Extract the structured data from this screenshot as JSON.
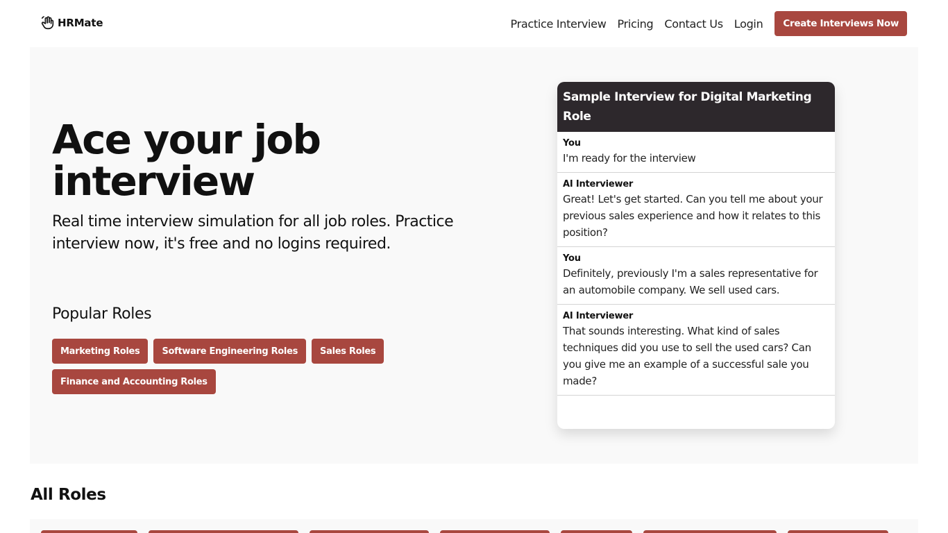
{
  "brand": {
    "name": "HRMate",
    "logo_icon": "hand-wave-icon"
  },
  "nav": {
    "links": [
      "Practice Interview",
      "Pricing",
      "Contact Us",
      "Login"
    ],
    "cta_label": "Create Interviews Now"
  },
  "hero": {
    "headline": "Ace your job interview",
    "subtitle": "Real time interview simulation for all job roles. Practice interview now, it's free and no logins required.",
    "popular_title": "Popular Roles",
    "popular_roles": [
      "Marketing Roles",
      "Software Engineering Roles",
      "Sales Roles",
      "Finance and Accounting Roles"
    ]
  },
  "sample": {
    "title": "Sample Interview for Digital Marketing Role",
    "messages": [
      {
        "who": "You",
        "text": "I'm ready for the interview"
      },
      {
        "who": "AI Interviewer",
        "text": "Great! Let's get started. Can you tell me about your previous sales experience and how it relates to this position?"
      },
      {
        "who": "You",
        "text": "Definitely, previously I'm a sales representative for an automobile company. We sell used cars."
      },
      {
        "who": "AI Interviewer",
        "text": "That sounds interesting. What kind of sales techniques did you use to sell the used cars? Can you give me an example of a successful sale you made?"
      }
    ]
  },
  "all_roles_title": "All Roles",
  "colors": {
    "accent": "#a8473f",
    "card_header": "#2d282c",
    "hero_bg": "#f9f9f9"
  }
}
